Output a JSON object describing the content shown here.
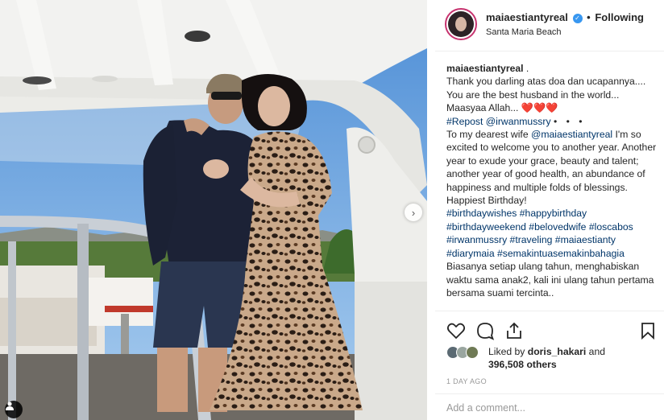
{
  "post": {
    "username": "maiaestiantyreal",
    "verified_icon": "verified-badge-icon",
    "separator": "•",
    "follow_label": "Following",
    "location": "Santa Maria Beach"
  },
  "caption": {
    "author": "maiaestiantyreal",
    "trailing": ".",
    "line1": "Thank you darling atas doa dan ucapannya.... You are the best husband in the world... Maasyaa Allah...",
    "hearts": "❤️❤️❤️",
    "repost": "#Repost @irwanmussry",
    "more": "• • •",
    "mention_prefix": "To my dearest wife",
    "mention": "@maiaestiantyreal",
    "body": "I'm so excited to welcome you to another year. Another year to exude your grace, beauty and talent; another year of good health, an abundance of happiness and multiple folds of blessings. Happiest Birthday!",
    "hashtags": "#birthdaywishes #happybirthday #birthdayweekend #belovedwife #loscabos #irwanmussry #traveling #maiaestianty #diarymaia #semakintuasemakinbahagia",
    "closing": "Biasanya setiap ulang tahun, menghabiskan waktu sama anak2, kali ini ulang tahun pertama bersama suami tercinta.."
  },
  "likes": {
    "prefix": "Liked by",
    "by_user": "doris_hakari",
    "and": "and",
    "count": "396,508 others"
  },
  "date": "1 DAY AGO",
  "comment": {
    "placeholder": "Add a comment..."
  },
  "icons": {
    "like": "heart-icon",
    "comment": "comment-icon",
    "share": "share-icon",
    "save": "bookmark-icon",
    "next": "chevron-right-icon",
    "tag": "user-tag-icon"
  },
  "colors": {
    "link": "#003569",
    "accent": "#3897f0",
    "heart": "#ed4956",
    "muted": "#999999"
  }
}
